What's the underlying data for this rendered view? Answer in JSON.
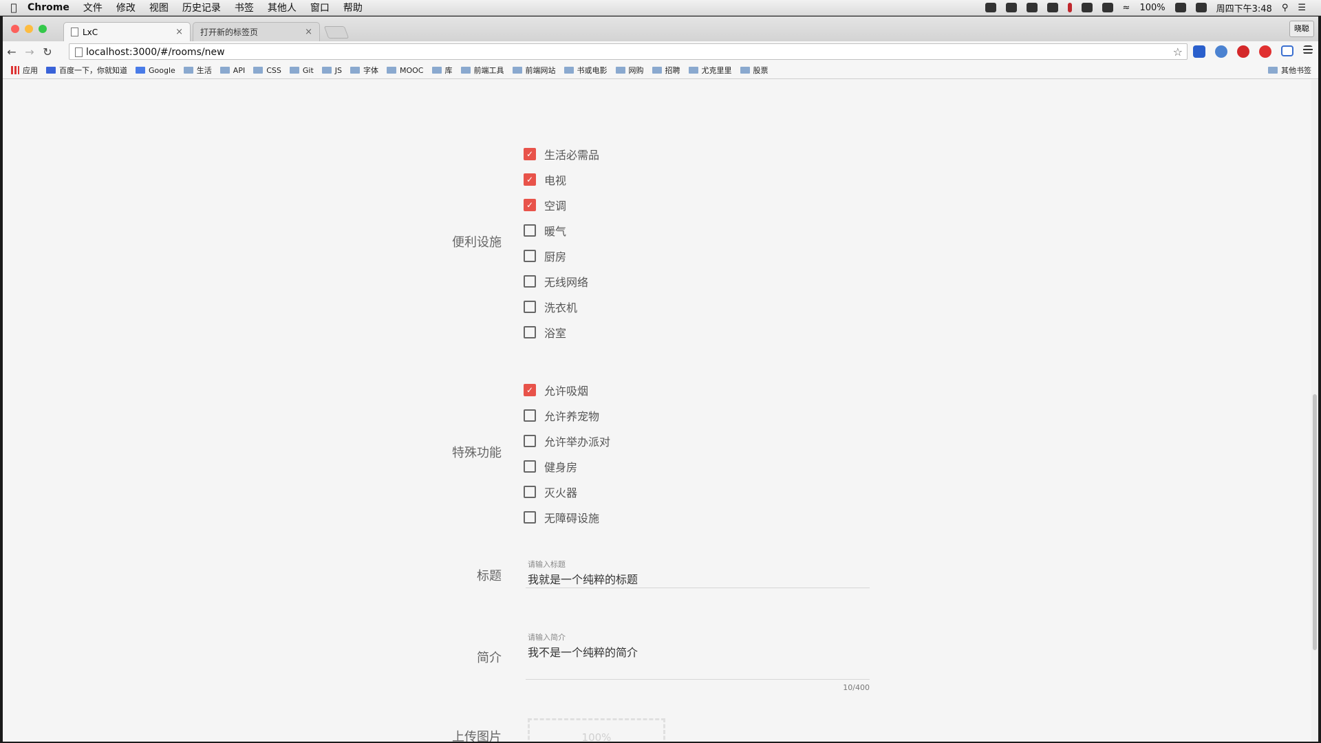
{
  "menubar": {
    "app_name": "Chrome",
    "items": [
      "文件",
      "修改",
      "视图",
      "历史记录",
      "书签",
      "其他人",
      "窗口",
      "帮助"
    ],
    "battery": "100%",
    "clock": "周四下午3:48"
  },
  "browser": {
    "tabs": [
      {
        "title": "LxC"
      },
      {
        "title": "打开新的标签页"
      }
    ],
    "profile_name": "晓聪",
    "url": "localhost:3000/#/rooms/new",
    "bookmarks": [
      "应用",
      "百度一下，你就知道",
      "Google",
      "生活",
      "API",
      "CSS",
      "Git",
      "JS",
      "字体",
      "MOOC",
      "库",
      "前端工具",
      "前端网站",
      "书或电影",
      "网购",
      "招聘",
      "尤克里里",
      "股票"
    ],
    "bookmarks_other": "其他书签"
  },
  "form": {
    "amenities": {
      "label": "便利设施",
      "options": [
        {
          "label": "生活必需品",
          "checked": true
        },
        {
          "label": "电视",
          "checked": true
        },
        {
          "label": "空调",
          "checked": true
        },
        {
          "label": "暖气",
          "checked": false
        },
        {
          "label": "厨房",
          "checked": false
        },
        {
          "label": "无线网络",
          "checked": false
        },
        {
          "label": "洗衣机",
          "checked": false
        },
        {
          "label": "浴室",
          "checked": false
        }
      ]
    },
    "features": {
      "label": "特殊功能",
      "options": [
        {
          "label": "允许吸烟",
          "checked": true
        },
        {
          "label": "允许养宠物",
          "checked": false
        },
        {
          "label": "允许举办派对",
          "checked": false
        },
        {
          "label": "健身房",
          "checked": false
        },
        {
          "label": "灭火器",
          "checked": false
        },
        {
          "label": "无障碍设施",
          "checked": false
        }
      ]
    },
    "title": {
      "label": "标题",
      "hint": "请输入标题",
      "value": "我就是一个纯粹的标题"
    },
    "intro": {
      "label": "简介",
      "hint": "请输入简介",
      "value": "我不是一个纯粹的简介",
      "counter": "10/400"
    },
    "upload": {
      "label": "上传图片",
      "progress_text": "100%"
    }
  },
  "colors": {
    "checkbox_checked": "#e8534a"
  }
}
